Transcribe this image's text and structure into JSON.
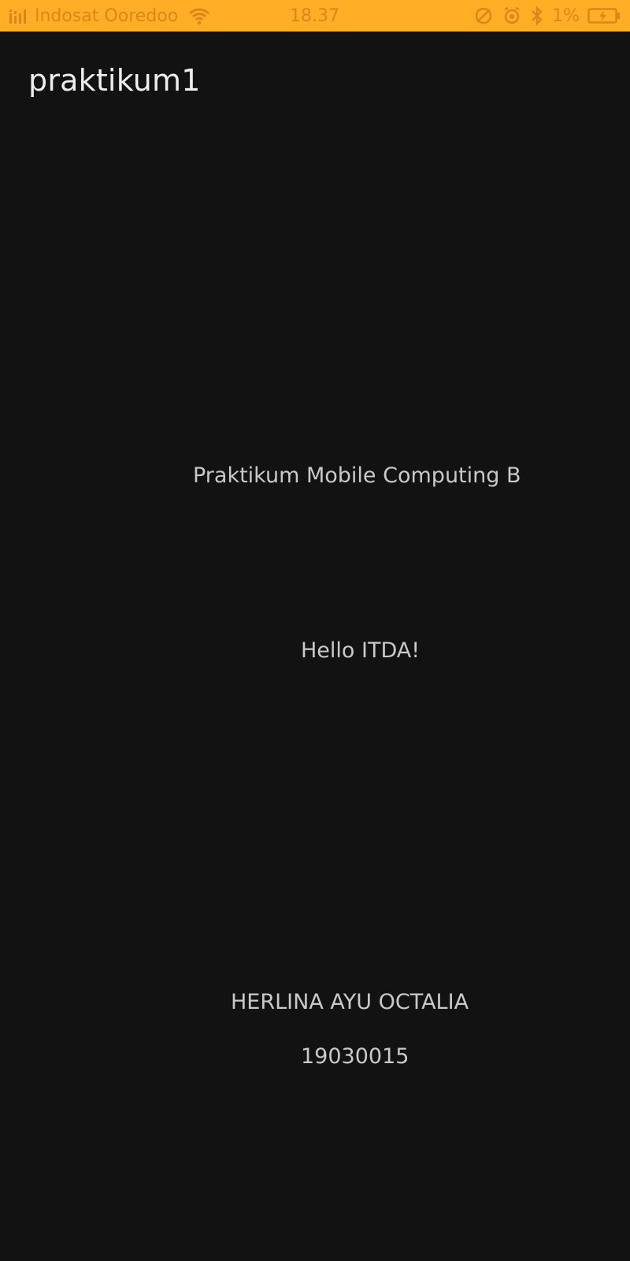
{
  "status_bar": {
    "carrier": "Indosat Ooredoo",
    "time": "18.37",
    "battery_percent": "1%",
    "background_color": "#FFAE26",
    "icons": [
      "signal-icon",
      "wifi-icon",
      "mute-icon",
      "alarm-icon",
      "bluetooth-icon",
      "battery-icon"
    ]
  },
  "app_bar": {
    "title": "praktikum1"
  },
  "content": {
    "course": "Praktikum Mobile Computing B",
    "greeting": "Hello ITDA!",
    "student_name": "HERLINA AYU OCTALIA",
    "student_id": "19030015"
  },
  "colors": {
    "background": "#121212",
    "title_text": "#EDEDED",
    "body_text": "#C9C9C9"
  }
}
